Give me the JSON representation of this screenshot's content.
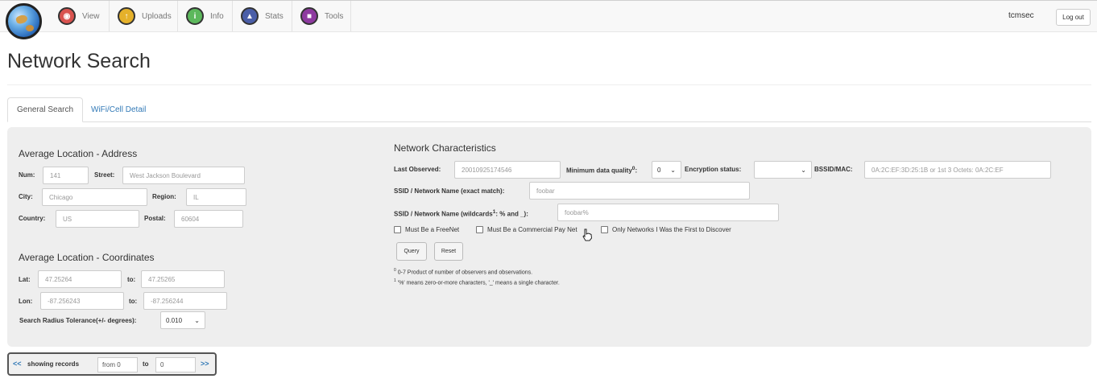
{
  "nav": {
    "items": [
      {
        "label": "View",
        "icon": "view-icon",
        "color": "#d9534f"
      },
      {
        "label": "Uploads",
        "icon": "uploads-icon",
        "color": "#e5b12a"
      },
      {
        "label": "Info",
        "icon": "info-icon",
        "color": "#5cb85c"
      },
      {
        "label": "Stats",
        "icon": "stats-icon",
        "color": "#4a5ea8"
      },
      {
        "label": "Tools",
        "icon": "tools-icon",
        "color": "#8e3aa0"
      }
    ],
    "user": "tcmsec",
    "logout_label": "Log out"
  },
  "page": {
    "title": "Network Search",
    "tabs": [
      {
        "label": "General Search",
        "active": true
      },
      {
        "label": "WiFi/Cell Detail",
        "active": false
      }
    ]
  },
  "address": {
    "title": "Average Location - Address",
    "num_label": "Num:",
    "num_value": "141",
    "street_label": "Street:",
    "street_value": "West Jackson Boulevard",
    "city_label": "City:",
    "city_value": "Chicago",
    "region_label": "Region:",
    "region_value": "IL",
    "country_label": "Country:",
    "country_value": "US",
    "postal_label": "Postal:",
    "postal_value": "60604"
  },
  "coords": {
    "title": "Average Location - Coordinates",
    "lat_label": "Lat:",
    "lat_from": "47.25264",
    "lat_to_label": "to:",
    "lat_to": "47.25265",
    "lon_label": "Lon:",
    "lon_from": "-87.256243",
    "lon_to_label": "to:",
    "lon_to": "-87.256244",
    "radius_label": "Search Radius Tolerance(+/- degrees):",
    "radius_value": "0.010"
  },
  "network": {
    "title": "Network Characteristics",
    "last_observed_label": "Last Observed:",
    "last_observed_placeholder": "20010925174546",
    "min_quality_label": "Minimum data quality",
    "min_quality_sup": "0",
    "min_quality_value": "0",
    "encryption_label": "Encryption status:",
    "encryption_value": "",
    "bssid_label": "BSSID/MAC:",
    "bssid_placeholder": "0A:2C:EF:3D:25:1B or 1st 3 Octets: 0A:2C:EF",
    "ssid_exact_label": "SSID / Network Name (exact match):",
    "ssid_exact_placeholder": "foobar",
    "ssid_wild_label_a": "SSID / Network Name (wildcards",
    "ssid_wild_sup": "1",
    "ssid_wild_label_b": ": % and _):",
    "ssid_wild_placeholder": "foobar%",
    "chk_freenet": "Must Be a FreeNet",
    "chk_commercial": "Must Be a Commercial Pay Net",
    "chk_first": "Only Networks I Was the First to Discover",
    "query_label": "Query",
    "reset_label": "Reset",
    "note0_sup": "0",
    "note0_text": "0-7 Product of number of observers and observations.",
    "note1_sup": "1",
    "note1_text": "'%' means zero-or-more characters, '_' means a single character."
  },
  "pager": {
    "prev": "<<",
    "showing": "showing records",
    "from": "from 0",
    "to_label": "to",
    "to": "0",
    "next": ">>"
  }
}
